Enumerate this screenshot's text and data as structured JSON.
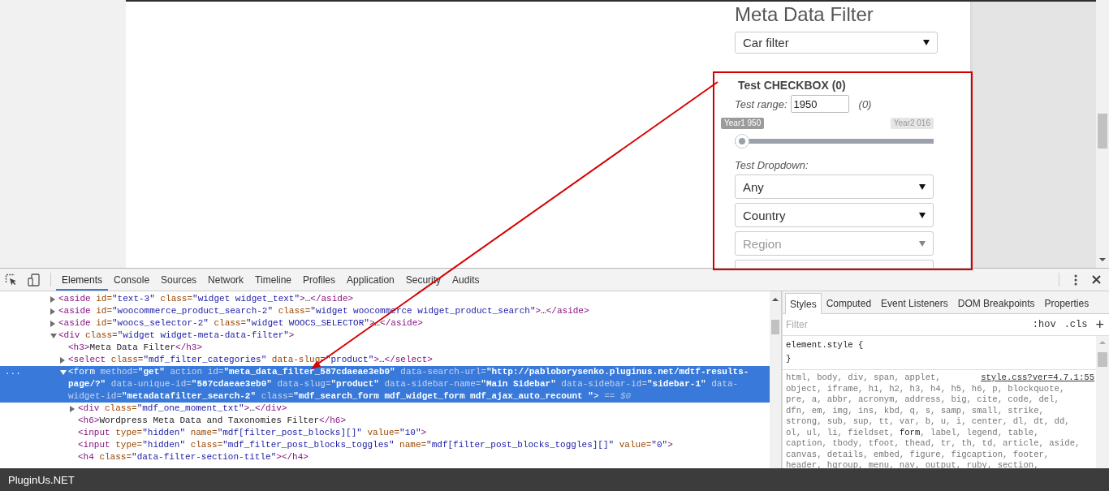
{
  "page": {
    "widget_title": "Meta Data Filter",
    "category_select": {
      "value": "Car filter"
    },
    "section": {
      "title": "Test CHECKBOX (0)",
      "range_label": "Test range:",
      "range_value": "1950",
      "range_count": "(0)",
      "slider": {
        "min_label": "Year1 950",
        "max_label": "Year2 016",
        "level": 0
      },
      "dropdown_label": "Test Dropdown:",
      "dropdowns": [
        {
          "value": "Any",
          "disabled": false
        },
        {
          "value": "Country",
          "disabled": false
        },
        {
          "value": "Region",
          "disabled": true
        }
      ]
    }
  },
  "devtools": {
    "tabs": [
      {
        "label": "Elements",
        "selected": true
      },
      {
        "label": "Console",
        "selected": false
      },
      {
        "label": "Sources",
        "selected": false
      },
      {
        "label": "Network",
        "selected": false
      },
      {
        "label": "Timeline",
        "selected": false
      },
      {
        "label": "Profiles",
        "selected": false
      },
      {
        "label": "Application",
        "selected": false
      },
      {
        "label": "Security",
        "selected": false
      },
      {
        "label": "Audits",
        "selected": false
      }
    ],
    "selected_line_dots": "...",
    "dom_tree": [
      {
        "kind": "collapsed",
        "selected": false,
        "tokens": [
          {
            "kind": "tag",
            "text": "<aside"
          },
          {
            "kind": "attr",
            "text": " id="
          },
          {
            "kind": "value",
            "text": "\"text-3\""
          },
          {
            "kind": "attr",
            "text": " class="
          },
          {
            "kind": "value",
            "text": "\"widget widget_text\""
          },
          {
            "kind": "tag",
            "text": ">"
          },
          {
            "kind": "text",
            "text": "…"
          },
          {
            "kind": "tag",
            "text": "</aside>"
          }
        ]
      },
      {
        "kind": "collapsed",
        "selected": false,
        "tokens": [
          {
            "kind": "tag",
            "text": "<aside"
          },
          {
            "kind": "attr",
            "text": " id="
          },
          {
            "kind": "value",
            "text": "\"woocommerce_product_search-2\""
          },
          {
            "kind": "attr",
            "text": " class="
          },
          {
            "kind": "value",
            "text": "\"widget woocommerce widget_product_search\""
          },
          {
            "kind": "tag",
            "text": ">"
          },
          {
            "kind": "text",
            "text": "…"
          },
          {
            "kind": "tag",
            "text": "</aside>"
          }
        ]
      },
      {
        "kind": "collapsed",
        "selected": false,
        "tokens": [
          {
            "kind": "tag",
            "text": "<aside"
          },
          {
            "kind": "attr",
            "text": " id="
          },
          {
            "kind": "value",
            "text": "\"woocs_selector-2\""
          },
          {
            "kind": "attr",
            "text": " class="
          },
          {
            "kind": "value",
            "text": "\"widget WOOCS_SELECTOR\""
          },
          {
            "kind": "tag",
            "text": ">"
          },
          {
            "kind": "text",
            "text": "…"
          },
          {
            "kind": "tag",
            "text": "</aside>"
          }
        ]
      },
      {
        "kind": "expanded",
        "selected": false,
        "tokens": [
          {
            "kind": "tag",
            "text": "<div"
          },
          {
            "kind": "attr",
            "text": " class="
          },
          {
            "kind": "value",
            "text": "\"widget widget-meta-data-filter\""
          },
          {
            "kind": "tag",
            "text": ">"
          }
        ],
        "children": [
          {
            "kind": "leaf",
            "selected": false,
            "tokens": [
              {
                "kind": "tag",
                "text": "<h3>"
              },
              {
                "kind": "text",
                "text": "Meta Data Filter"
              },
              {
                "kind": "tag",
                "text": "</h3>"
              }
            ]
          },
          {
            "kind": "collapsed",
            "selected": false,
            "tokens": [
              {
                "kind": "tag",
                "text": "<select"
              },
              {
                "kind": "attr",
                "text": " class="
              },
              {
                "kind": "value",
                "text": "\"mdf_filter_categories\""
              },
              {
                "kind": "attr",
                "text": " data-slug="
              },
              {
                "kind": "value",
                "text": "\"product\""
              },
              {
                "kind": "tag",
                "text": ">"
              },
              {
                "kind": "text",
                "text": "…"
              },
              {
                "kind": "tag",
                "text": "</select>"
              }
            ]
          },
          {
            "kind": "expanded",
            "selected": true,
            "tokens": [
              {
                "kind": "tag",
                "text": "<form"
              },
              {
                "kind": "attr",
                "text": " method="
              },
              {
                "kind": "value",
                "text": "\"get\""
              },
              {
                "kind": "attr",
                "text": " action id="
              },
              {
                "kind": "value",
                "text": "\"meta_data_filter_587cdaeae3eb0\""
              },
              {
                "kind": "attr",
                "text": " data-search-url="
              },
              {
                "kind": "value",
                "text": "\"http://pabloborysenko.pluginus.net/mdtf-results-page/?\""
              },
              {
                "kind": "attr",
                "text": " data-unique-id="
              },
              {
                "kind": "value",
                "text": "\"587cdaeae3eb0\""
              },
              {
                "kind": "attr",
                "text": " data-slug="
              },
              {
                "kind": "value",
                "text": "\"product\""
              },
              {
                "kind": "attr",
                "text": " data-sidebar-name="
              },
              {
                "kind": "value",
                "text": "\"Main Sidebar\""
              },
              {
                "kind": "attr",
                "text": " data-sidebar-id="
              },
              {
                "kind": "value",
                "text": "\"sidebar-1\""
              },
              {
                "kind": "attr",
                "text": " data-widget-id="
              },
              {
                "kind": "value",
                "text": "\"metadatafilter_search-2\""
              },
              {
                "kind": "attr",
                "text": " class="
              },
              {
                "kind": "value",
                "text": "\"mdf_search_form mdf_widget_form mdf_ajax_auto_recount \""
              },
              {
                "kind": "tag",
                "text": ">"
              },
              {
                "kind": "marker",
                "text": " == $0"
              }
            ],
            "children": [
              {
                "kind": "collapsed",
                "selected": false,
                "tokens": [
                  {
                    "kind": "tag",
                    "text": "<div"
                  },
                  {
                    "kind": "attr",
                    "text": " class="
                  },
                  {
                    "kind": "value",
                    "text": "\"mdf_one_moment_txt\""
                  },
                  {
                    "kind": "tag",
                    "text": ">"
                  },
                  {
                    "kind": "text",
                    "text": "…"
                  },
                  {
                    "kind": "tag",
                    "text": "</div>"
                  }
                ]
              },
              {
                "kind": "leaf",
                "selected": false,
                "tokens": [
                  {
                    "kind": "tag",
                    "text": "<h6>"
                  },
                  {
                    "kind": "text",
                    "text": "Wordpress Meta Data and Taxonomies Filter"
                  },
                  {
                    "kind": "tag",
                    "text": "</h6>"
                  }
                ]
              },
              {
                "kind": "leaf",
                "selected": false,
                "tokens": [
                  {
                    "kind": "tag",
                    "text": "<input"
                  },
                  {
                    "kind": "attr",
                    "text": " type="
                  },
                  {
                    "kind": "value",
                    "text": "\"hidden\""
                  },
                  {
                    "kind": "attr",
                    "text": " name="
                  },
                  {
                    "kind": "value",
                    "text": "\"mdf[filter_post_blocks][]\""
                  },
                  {
                    "kind": "attr",
                    "text": " value="
                  },
                  {
                    "kind": "value",
                    "text": "\"10\""
                  },
                  {
                    "kind": "tag",
                    "text": ">"
                  }
                ]
              },
              {
                "kind": "leaf",
                "selected": false,
                "tokens": [
                  {
                    "kind": "tag",
                    "text": "<input"
                  },
                  {
                    "kind": "attr",
                    "text": " type="
                  },
                  {
                    "kind": "value",
                    "text": "\"hidden\""
                  },
                  {
                    "kind": "attr",
                    "text": " class="
                  },
                  {
                    "kind": "value",
                    "text": "\"mdf_filter_post_blocks_toggles\""
                  },
                  {
                    "kind": "attr",
                    "text": " name="
                  },
                  {
                    "kind": "value",
                    "text": "\"mdf[filter_post_blocks_toggles][]\""
                  },
                  {
                    "kind": "attr",
                    "text": " value="
                  },
                  {
                    "kind": "value",
                    "text": "\"0\""
                  },
                  {
                    "kind": "tag",
                    "text": ">"
                  }
                ]
              },
              {
                "kind": "leaf",
                "selected": false,
                "tokens": [
                  {
                    "kind": "tag",
                    "text": "<h4"
                  },
                  {
                    "kind": "attr",
                    "text": " class="
                  },
                  {
                    "kind": "value",
                    "text": "\"data-filter-section-title\""
                  },
                  {
                    "kind": "tag",
                    "text": ">"
                  },
                  {
                    "kind": "tag",
                    "text": "</h4>"
                  }
                ]
              }
            ]
          }
        ]
      }
    ],
    "styles_tabs": [
      {
        "label": "Styles",
        "selected": true
      },
      {
        "label": "Computed",
        "selected": false
      },
      {
        "label": "Event Listeners",
        "selected": false
      },
      {
        "label": "DOM Breakpoints",
        "selected": false
      },
      {
        "label": "Properties",
        "selected": false
      }
    ],
    "filter": {
      "placeholder": "Filter"
    },
    "filter_buttons": [
      ":hov",
      ".cls",
      "+"
    ],
    "rules": [
      {
        "lines": [
          [
            {
              "text": "element.style {",
              "matched": true
            }
          ],
          [
            {
              "text": "}",
              "matched": true
            }
          ]
        ]
      },
      {
        "source": "style.css?ver=4.7.1:55",
        "lines": [
          [
            {
              "text": "html, body, div, span, applet,",
              "matched": false
            }
          ],
          [
            {
              "text": "object, iframe, h1, h2, h3, h4, h5, h6, p, blockquote,",
              "matched": false
            }
          ],
          [
            {
              "text": "pre, a, abbr, acronym, address, big, cite, code, del,",
              "matched": false
            }
          ],
          [
            {
              "text": "dfn, em, img, ins, kbd, q, s, samp, small, strike,",
              "matched": false
            }
          ],
          [
            {
              "text": "strong, sub, sup, tt, var, b, u, i, center, dl, dt, dd,",
              "matched": false
            }
          ],
          [
            {
              "text": "ol, ul, li, fieldset, ",
              "matched": false
            },
            {
              "text": "form",
              "matched": true
            },
            {
              "text": ", label, legend, table,",
              "matched": false
            }
          ],
          [
            {
              "text": "caption, tbody, tfoot, thead, tr, th, td, article, aside,",
              "matched": false
            }
          ],
          [
            {
              "text": "canvas, details, embed, figure, figcaption, footer,",
              "matched": false
            }
          ],
          [
            {
              "text": "header, hgroup, menu, nav, output, ruby, section,",
              "matched": false
            }
          ]
        ]
      }
    ]
  },
  "footer": {
    "brand": "PluginUs.NET"
  }
}
